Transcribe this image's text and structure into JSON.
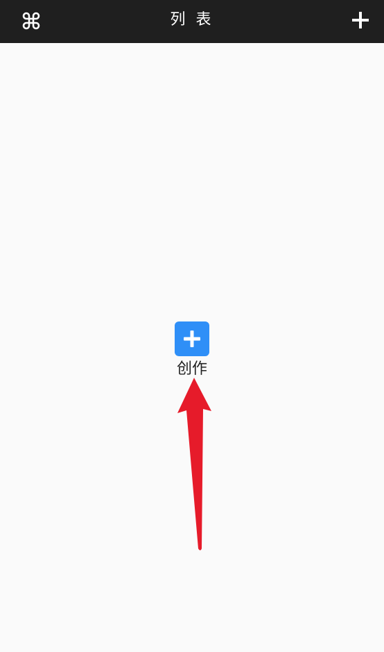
{
  "topbar": {
    "title": "列 表",
    "menu_icon": "command-icon",
    "add_icon": "plus-icon",
    "background": "#1f1f1f"
  },
  "main": {
    "create_label": "创作",
    "create_icon": "plus-icon",
    "accent": "#2f8ff7"
  },
  "annotation": {
    "arrow_color": "#e61b2a"
  }
}
